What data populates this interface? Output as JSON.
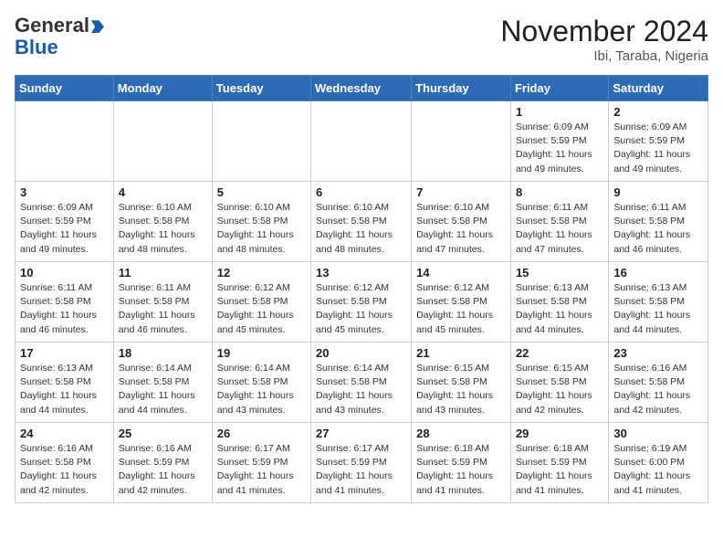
{
  "header": {
    "logo_general": "General",
    "logo_blue": "Blue",
    "month_title": "November 2024",
    "location": "Ibi, Taraba, Nigeria"
  },
  "weekdays": [
    "Sunday",
    "Monday",
    "Tuesday",
    "Wednesday",
    "Thursday",
    "Friday",
    "Saturday"
  ],
  "weeks": [
    [
      {
        "day": "",
        "info": ""
      },
      {
        "day": "",
        "info": ""
      },
      {
        "day": "",
        "info": ""
      },
      {
        "day": "",
        "info": ""
      },
      {
        "day": "",
        "info": ""
      },
      {
        "day": "1",
        "info": "Sunrise: 6:09 AM\nSunset: 5:59 PM\nDaylight: 11 hours\nand 49 minutes."
      },
      {
        "day": "2",
        "info": "Sunrise: 6:09 AM\nSunset: 5:59 PM\nDaylight: 11 hours\nand 49 minutes."
      }
    ],
    [
      {
        "day": "3",
        "info": "Sunrise: 6:09 AM\nSunset: 5:59 PM\nDaylight: 11 hours\nand 49 minutes."
      },
      {
        "day": "4",
        "info": "Sunrise: 6:10 AM\nSunset: 5:58 PM\nDaylight: 11 hours\nand 48 minutes."
      },
      {
        "day": "5",
        "info": "Sunrise: 6:10 AM\nSunset: 5:58 PM\nDaylight: 11 hours\nand 48 minutes."
      },
      {
        "day": "6",
        "info": "Sunrise: 6:10 AM\nSunset: 5:58 PM\nDaylight: 11 hours\nand 48 minutes."
      },
      {
        "day": "7",
        "info": "Sunrise: 6:10 AM\nSunset: 5:58 PM\nDaylight: 11 hours\nand 47 minutes."
      },
      {
        "day": "8",
        "info": "Sunrise: 6:11 AM\nSunset: 5:58 PM\nDaylight: 11 hours\nand 47 minutes."
      },
      {
        "day": "9",
        "info": "Sunrise: 6:11 AM\nSunset: 5:58 PM\nDaylight: 11 hours\nand 46 minutes."
      }
    ],
    [
      {
        "day": "10",
        "info": "Sunrise: 6:11 AM\nSunset: 5:58 PM\nDaylight: 11 hours\nand 46 minutes."
      },
      {
        "day": "11",
        "info": "Sunrise: 6:11 AM\nSunset: 5:58 PM\nDaylight: 11 hours\nand 46 minutes."
      },
      {
        "day": "12",
        "info": "Sunrise: 6:12 AM\nSunset: 5:58 PM\nDaylight: 11 hours\nand 45 minutes."
      },
      {
        "day": "13",
        "info": "Sunrise: 6:12 AM\nSunset: 5:58 PM\nDaylight: 11 hours\nand 45 minutes."
      },
      {
        "day": "14",
        "info": "Sunrise: 6:12 AM\nSunset: 5:58 PM\nDaylight: 11 hours\nand 45 minutes."
      },
      {
        "day": "15",
        "info": "Sunrise: 6:13 AM\nSunset: 5:58 PM\nDaylight: 11 hours\nand 44 minutes."
      },
      {
        "day": "16",
        "info": "Sunrise: 6:13 AM\nSunset: 5:58 PM\nDaylight: 11 hours\nand 44 minutes."
      }
    ],
    [
      {
        "day": "17",
        "info": "Sunrise: 6:13 AM\nSunset: 5:58 PM\nDaylight: 11 hours\nand 44 minutes."
      },
      {
        "day": "18",
        "info": "Sunrise: 6:14 AM\nSunset: 5:58 PM\nDaylight: 11 hours\nand 44 minutes."
      },
      {
        "day": "19",
        "info": "Sunrise: 6:14 AM\nSunset: 5:58 PM\nDaylight: 11 hours\nand 43 minutes."
      },
      {
        "day": "20",
        "info": "Sunrise: 6:14 AM\nSunset: 5:58 PM\nDaylight: 11 hours\nand 43 minutes."
      },
      {
        "day": "21",
        "info": "Sunrise: 6:15 AM\nSunset: 5:58 PM\nDaylight: 11 hours\nand 43 minutes."
      },
      {
        "day": "22",
        "info": "Sunrise: 6:15 AM\nSunset: 5:58 PM\nDaylight: 11 hours\nand 42 minutes."
      },
      {
        "day": "23",
        "info": "Sunrise: 6:16 AM\nSunset: 5:58 PM\nDaylight: 11 hours\nand 42 minutes."
      }
    ],
    [
      {
        "day": "24",
        "info": "Sunrise: 6:16 AM\nSunset: 5:58 PM\nDaylight: 11 hours\nand 42 minutes."
      },
      {
        "day": "25",
        "info": "Sunrise: 6:16 AM\nSunset: 5:59 PM\nDaylight: 11 hours\nand 42 minutes."
      },
      {
        "day": "26",
        "info": "Sunrise: 6:17 AM\nSunset: 5:59 PM\nDaylight: 11 hours\nand 41 minutes."
      },
      {
        "day": "27",
        "info": "Sunrise: 6:17 AM\nSunset: 5:59 PM\nDaylight: 11 hours\nand 41 minutes."
      },
      {
        "day": "28",
        "info": "Sunrise: 6:18 AM\nSunset: 5:59 PM\nDaylight: 11 hours\nand 41 minutes."
      },
      {
        "day": "29",
        "info": "Sunrise: 6:18 AM\nSunset: 5:59 PM\nDaylight: 11 hours\nand 41 minutes."
      },
      {
        "day": "30",
        "info": "Sunrise: 6:19 AM\nSunset: 6:00 PM\nDaylight: 11 hours\nand 41 minutes."
      }
    ]
  ]
}
